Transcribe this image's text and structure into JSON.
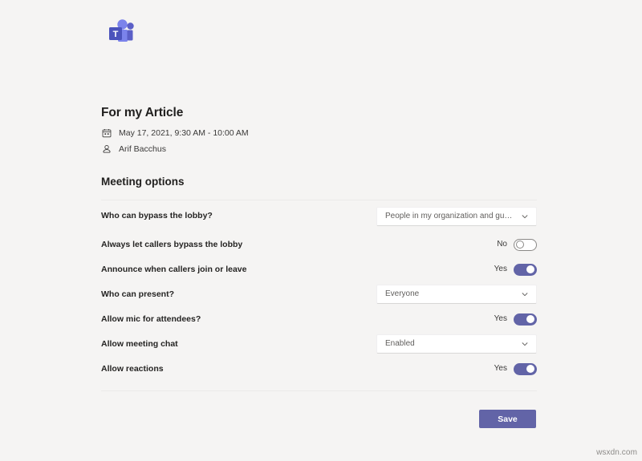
{
  "app": {
    "logo_name": "microsoft-teams-logo",
    "brand_color": "#6264a7",
    "background_color": "#f5f4f3"
  },
  "meeting": {
    "title": "For my Article",
    "date_icon": "calendar-icon",
    "date_time": "May 17, 2021, 9:30 AM - 10:00 AM",
    "organizer_icon": "person-icon",
    "organizer": "Arif Bacchus"
  },
  "section": {
    "title": "Meeting options"
  },
  "options": [
    {
      "label": "Who can bypass the lobby?",
      "control": "dropdown",
      "value": "People in my organization and gu…",
      "name": "who-can-bypass-lobby"
    },
    {
      "label": "Always let callers bypass the lobby",
      "control": "toggle",
      "value": "No",
      "state": "off",
      "name": "always-let-callers-bypass-lobby"
    },
    {
      "label": "Announce when callers join or leave",
      "control": "toggle",
      "value": "Yes",
      "state": "on",
      "name": "announce-when-callers-join-or-leave"
    },
    {
      "label": "Who can present?",
      "control": "dropdown",
      "value": "Everyone",
      "name": "who-can-present"
    },
    {
      "label": "Allow mic for attendees?",
      "control": "toggle",
      "value": "Yes",
      "state": "on",
      "name": "allow-mic-for-attendees"
    },
    {
      "label": "Allow meeting chat",
      "control": "dropdown",
      "value": "Enabled",
      "name": "allow-meeting-chat"
    },
    {
      "label": "Allow reactions",
      "control": "toggle",
      "value": "Yes",
      "state": "on",
      "name": "allow-reactions"
    }
  ],
  "footer": {
    "save_label": "Save"
  },
  "watermark": {
    "text": "wsxdn.com"
  }
}
